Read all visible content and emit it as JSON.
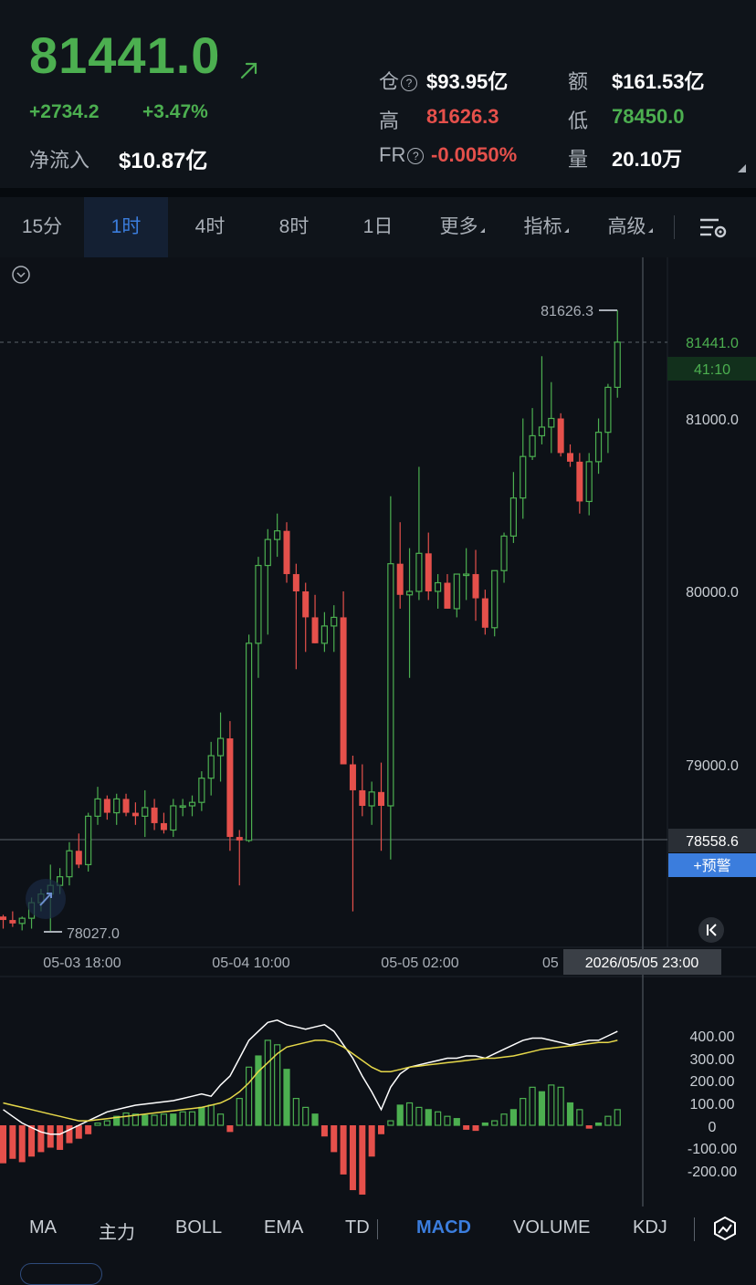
{
  "ticker": {
    "last_price": "81441.0",
    "change_abs": "+2734.2",
    "change_pct": "+3.47%",
    "net_inflow_label": "净流入",
    "net_inflow_value": "$10.87亿"
  },
  "stats": {
    "open_interest_label": "仓",
    "open_interest_value": "$93.95亿",
    "turnover_label": "额",
    "turnover_value": "$161.53亿",
    "high_label": "高",
    "high_value": "81626.3",
    "low_label": "低",
    "low_value": "78450.0",
    "funding_label": "FR",
    "funding_value": "-0.0050%",
    "volume_label": "量",
    "volume_value": "20.10万",
    "help_glyph": "?"
  },
  "timeframes": [
    {
      "label": "15分",
      "active": false
    },
    {
      "label": "1时",
      "active": true
    },
    {
      "label": "4时",
      "active": false
    },
    {
      "label": "8时",
      "active": false
    },
    {
      "label": "1日",
      "active": false
    },
    {
      "label": "更多",
      "active": false
    },
    {
      "label": "指标",
      "active": false
    },
    {
      "label": "高级",
      "active": false
    }
  ],
  "chart": {
    "price_axis": [
      "81000.0",
      "80000.0",
      "79000.0"
    ],
    "last_price_tag": "81441.0",
    "countdown_tag": "41:10",
    "crosshair_price_tag": "78558.6",
    "alert_button": "+预警",
    "high_marker": "81626.3",
    "low_marker": "78027.0",
    "time_axis": [
      "05-03 18:00",
      "05-04 10:00",
      "05-05 02:00",
      "05"
    ],
    "crosshair_time_tag": "2026/05/05 23:00",
    "colors": {
      "up": "#4caf50",
      "down": "#e5504b",
      "accent": "#3b7ddd"
    }
  },
  "macd": {
    "axis": [
      "400.00",
      "300.00",
      "200.00",
      "100.00",
      "0",
      "-100.00",
      "-200.00"
    ]
  },
  "indicators": [
    {
      "label": "MA",
      "active": false
    },
    {
      "label": "主力",
      "active": false
    },
    {
      "label": "BOLL",
      "active": false
    },
    {
      "label": "EMA",
      "active": false
    },
    {
      "label": "TD",
      "active": false
    },
    {
      "label": "MACD",
      "active": true
    },
    {
      "label": "VOLUME",
      "active": false
    },
    {
      "label": "KDJ",
      "active": false
    }
  ],
  "chart_data": {
    "type": "candlestick",
    "interval": "1h",
    "ylim": [
      78000,
      81700
    ],
    "candles": [
      [
        78120,
        78130,
        78050,
        78100
      ],
      [
        78100,
        78150,
        78060,
        78080
      ],
      [
        78080,
        78120,
        78040,
        78110
      ],
      [
        78110,
        78230,
        78050,
        78200
      ],
      [
        78200,
        78280,
        78150,
        78250
      ],
      [
        78250,
        78420,
        78030,
        78300
      ],
      [
        78300,
        78400,
        78250,
        78350
      ],
      [
        78350,
        78550,
        78300,
        78500
      ],
      [
        78500,
        78600,
        78400,
        78420
      ],
      [
        78420,
        78720,
        78380,
        78700
      ],
      [
        78700,
        78870,
        78650,
        78800
      ],
      [
        78800,
        78820,
        78680,
        78720
      ],
      [
        78720,
        78830,
        78650,
        78800
      ],
      [
        78800,
        78830,
        78700,
        78720
      ],
      [
        78720,
        78780,
        78650,
        78700
      ],
      [
        78700,
        78850,
        78580,
        78750
      ],
      [
        78750,
        78800,
        78620,
        78660
      ],
      [
        78660,
        78720,
        78600,
        78620
      ],
      [
        78620,
        78800,
        78580,
        78760
      ],
      [
        78760,
        78800,
        78700,
        78760
      ],
      [
        78760,
        78820,
        78700,
        78780
      ],
      [
        78780,
        78960,
        78730,
        78920
      ],
      [
        78920,
        79130,
        78820,
        79050
      ],
      [
        79050,
        79300,
        78900,
        79150
      ],
      [
        79150,
        79250,
        78500,
        78580
      ],
      [
        78580,
        78620,
        78300,
        78560
      ],
      [
        78560,
        79750,
        78550,
        79700
      ],
      [
        79700,
        80200,
        79500,
        80150
      ],
      [
        80150,
        80360,
        79750,
        80300
      ],
      [
        80300,
        80450,
        80200,
        80350
      ],
      [
        80350,
        80400,
        80050,
        80100
      ],
      [
        80100,
        80160,
        79550,
        80000
      ],
      [
        80000,
        80050,
        79650,
        79850
      ],
      [
        79850,
        79980,
        79700,
        79700
      ],
      [
        79700,
        79880,
        79650,
        79800
      ],
      [
        79800,
        79920,
        79650,
        79850
      ],
      [
        79850,
        80000,
        79700,
        79000
      ],
      [
        79000,
        79050,
        78150,
        78850
      ],
      [
        78850,
        79000,
        78700,
        78760
      ],
      [
        78760,
        78900,
        78650,
        78840
      ],
      [
        78840,
        79010,
        78500,
        78760
      ],
      [
        78760,
        80550,
        78450,
        80160
      ],
      [
        80160,
        80400,
        79900,
        79980
      ],
      [
        79980,
        80250,
        79500,
        80000
      ],
      [
        80000,
        80720,
        79950,
        80220
      ],
      [
        80220,
        80340,
        79950,
        80000
      ],
      [
        80000,
        80100,
        79900,
        80050
      ],
      [
        80050,
        80100,
        79900,
        79900
      ],
      [
        79900,
        80050,
        79850,
        80100
      ],
      [
        80100,
        80250,
        79950,
        80100
      ],
      [
        80100,
        80240,
        79830,
        79960
      ],
      [
        79960,
        80010,
        79750,
        79790
      ],
      [
        79790,
        80100,
        79740,
        80120
      ],
      [
        80120,
        80340,
        80050,
        80320
      ],
      [
        80320,
        80690,
        80280,
        80540
      ],
      [
        80540,
        81000,
        80420,
        80780
      ],
      [
        80780,
        81060,
        80760,
        80900
      ],
      [
        80900,
        81360,
        80850,
        80950
      ],
      [
        80950,
        81210,
        80800,
        81000
      ],
      [
        81000,
        81030,
        80780,
        80800
      ],
      [
        80800,
        80850,
        80720,
        80750
      ],
      [
        80750,
        80800,
        80450,
        80520
      ],
      [
        80520,
        80800,
        80440,
        80750
      ],
      [
        80750,
        81000,
        80680,
        80920
      ],
      [
        80920,
        81200,
        80800,
        81180
      ],
      [
        81180,
        81626.3,
        81120,
        81441
      ]
    ],
    "macd_hist": [
      -170,
      -150,
      -165,
      -140,
      -120,
      -100,
      -110,
      -80,
      -60,
      -40,
      10,
      20,
      40,
      55,
      50,
      45,
      45,
      50,
      50,
      60,
      60,
      80,
      90,
      50,
      -30,
      120,
      260,
      310,
      380,
      360,
      250,
      120,
      80,
      50,
      -50,
      -120,
      -220,
      -290,
      -310,
      -140,
      -40,
      20,
      90,
      100,
      80,
      70,
      60,
      40,
      30,
      -20,
      -25,
      10,
      20,
      50,
      70,
      120,
      170,
      150,
      180,
      170,
      100,
      70,
      -15,
      10,
      40,
      70
    ],
    "macd_dif": [
      70,
      40,
      10,
      -10,
      -30,
      -40,
      -40,
      -20,
      0,
      20,
      40,
      60,
      70,
      80,
      90,
      95,
      100,
      105,
      110,
      120,
      130,
      140,
      130,
      180,
      220,
      300,
      380,
      420,
      460,
      470,
      450,
      440,
      430,
      440,
      450,
      420,
      360,
      300,
      220,
      150,
      70,
      170,
      230,
      260,
      270,
      280,
      290,
      300,
      300,
      310,
      310,
      300,
      320,
      340,
      360,
      380,
      390,
      390,
      380,
      370,
      360,
      370,
      380,
      380,
      400,
      420
    ],
    "macd_dea": [
      100,
      90,
      80,
      70,
      60,
      50,
      40,
      30,
      20,
      20,
      25,
      30,
      35,
      40,
      45,
      50,
      55,
      60,
      65,
      70,
      75,
      80,
      90,
      100,
      120,
      150,
      190,
      240,
      280,
      320,
      350,
      360,
      370,
      380,
      380,
      370,
      350,
      320,
      290,
      260,
      240,
      240,
      250,
      260,
      265,
      270,
      275,
      280,
      285,
      290,
      295,
      300,
      300,
      305,
      310,
      320,
      330,
      340,
      345,
      350,
      355,
      360,
      365,
      370,
      370,
      380
    ]
  }
}
